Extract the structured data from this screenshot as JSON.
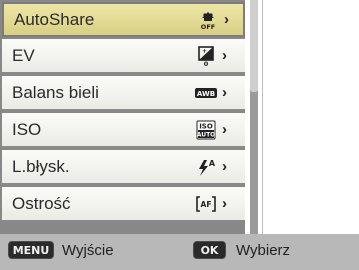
{
  "menu": {
    "items": [
      {
        "label": "AutoShare",
        "icon": "autoshare-off-icon",
        "icon_text": "OFF",
        "selected": true
      },
      {
        "label": "EV",
        "icon": "ev-icon",
        "icon_text": "0",
        "selected": false
      },
      {
        "label": "Balans bieli",
        "icon": "awb-icon",
        "icon_text": "AWB",
        "selected": false
      },
      {
        "label": "ISO",
        "icon": "iso-auto-icon",
        "icon_text": "ISO AUTO",
        "selected": false
      },
      {
        "label": "L.błysk.",
        "icon": "flash-auto-icon",
        "icon_text": "A",
        "selected": false
      },
      {
        "label": "Ostrość",
        "icon": "autofocus-icon",
        "icon_text": "AF",
        "selected": false
      }
    ]
  },
  "footer": {
    "menu_key": "MENU",
    "back_label": "Wyjście",
    "ok_key": "OK",
    "select_label": "Wybierz"
  },
  "colors": {
    "selected_bg": "#e6dd98",
    "item_bg": "#f7f7f3",
    "frame": "#888888",
    "footer_bg": "#b8b8b8"
  }
}
